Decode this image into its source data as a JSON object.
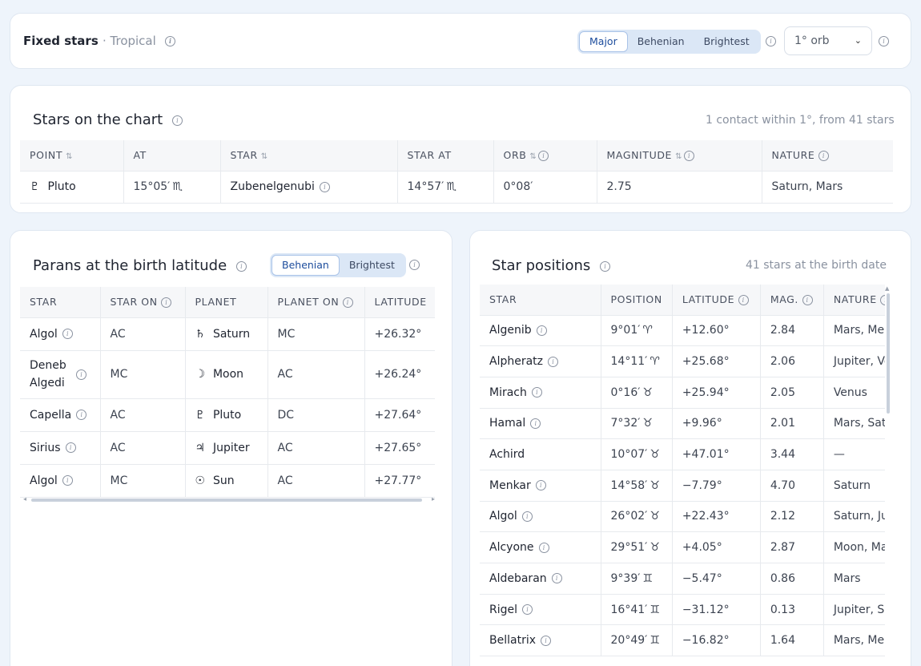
{
  "header": {
    "title": "Fixed stars",
    "subtitle": "· Tropical",
    "tabs": [
      "Major",
      "Behenian",
      "Brightest"
    ],
    "active_tab": "Major",
    "orb": "1° orb"
  },
  "chart_stars": {
    "title": "Stars on the chart",
    "meta": "1 contact within 1°, from 41 stars",
    "columns": [
      "POINT",
      "AT",
      "STAR",
      "STAR AT",
      "ORB",
      "MAGNITUDE",
      "NATURE"
    ],
    "rows": [
      {
        "glyph": "♇",
        "point": "Pluto",
        "at": "15°05′",
        "at_sign": "♏",
        "star": "Zubenelgenubi",
        "star_at": "14°57′",
        "star_sign": "♏",
        "orb": "0°08′",
        "magnitude": "2.75",
        "nature": "Saturn, Mars"
      }
    ]
  },
  "parans": {
    "title": "Parans at the birth latitude",
    "tabs": [
      "Behenian",
      "Brightest"
    ],
    "active_tab": "Behenian",
    "columns": [
      "STAR",
      "STAR ON",
      "PLANET",
      "PLANET ON",
      "LATITUDE"
    ],
    "rows": [
      {
        "star": "Algol",
        "star_on": "AC",
        "glyph": "♄",
        "planet": "Saturn",
        "planet_on": "MC",
        "latitude": "+26.32°"
      },
      {
        "star": "Deneb Algedi",
        "star_on": "MC",
        "glyph": "☽",
        "planet": "Moon",
        "planet_on": "AC",
        "latitude": "+26.24°"
      },
      {
        "star": "Capella",
        "star_on": "AC",
        "glyph": "♇",
        "planet": "Pluto",
        "planet_on": "DC",
        "latitude": "+27.64°"
      },
      {
        "star": "Sirius",
        "star_on": "AC",
        "glyph": "♃",
        "planet": "Jupiter",
        "planet_on": "AC",
        "latitude": "+27.65°"
      },
      {
        "star": "Algol",
        "star_on": "MC",
        "glyph": "☉",
        "planet": "Sun",
        "planet_on": "AC",
        "latitude": "+27.77°"
      }
    ]
  },
  "positions": {
    "title": "Star positions",
    "meta": "41 stars at the birth date",
    "columns": [
      "STAR",
      "POSITION",
      "LATITUDE",
      "MAG.",
      "NATURE"
    ],
    "rows": [
      {
        "star": "Algenib",
        "info": true,
        "position": "9°01′",
        "sign": "♈",
        "latitude": "+12.60°",
        "mag": "2.84",
        "nature": "Mars, Mercury"
      },
      {
        "star": "Alpheratz",
        "info": true,
        "position": "14°11′",
        "sign": "♈",
        "latitude": "+25.68°",
        "mag": "2.06",
        "nature": "Jupiter, Venus"
      },
      {
        "star": "Mirach",
        "info": true,
        "position": "0°16′",
        "sign": "♉",
        "latitude": "+25.94°",
        "mag": "2.05",
        "nature": "Venus"
      },
      {
        "star": "Hamal",
        "info": true,
        "position": "7°32′",
        "sign": "♉",
        "latitude": "+9.96°",
        "mag": "2.01",
        "nature": "Mars, Saturn"
      },
      {
        "star": "Achird",
        "info": false,
        "position": "10°07′",
        "sign": "♉",
        "latitude": "+47.01°",
        "mag": "3.44",
        "nature": "—"
      },
      {
        "star": "Menkar",
        "info": true,
        "position": "14°58′",
        "sign": "♉",
        "latitude": "−7.79°",
        "mag": "4.70",
        "nature": "Saturn"
      },
      {
        "star": "Algol",
        "info": true,
        "position": "26°02′",
        "sign": "♉",
        "latitude": "+22.43°",
        "mag": "2.12",
        "nature": "Saturn, Jupiter"
      },
      {
        "star": "Alcyone",
        "info": true,
        "position": "29°51′",
        "sign": "♉",
        "latitude": "+4.05°",
        "mag": "2.87",
        "nature": "Moon, Mars"
      },
      {
        "star": "Aldebaran",
        "info": true,
        "position": "9°39′",
        "sign": "♊",
        "latitude": "−5.47°",
        "mag": "0.86",
        "nature": "Mars"
      },
      {
        "star": "Rigel",
        "info": true,
        "position": "16°41′",
        "sign": "♊",
        "latitude": "−31.12°",
        "mag": "0.13",
        "nature": "Jupiter, Saturn"
      },
      {
        "star": "Bellatrix",
        "info": true,
        "position": "20°49′",
        "sign": "♊",
        "latitude": "−16.82°",
        "mag": "1.64",
        "nature": "Mars, Mercury"
      }
    ]
  }
}
